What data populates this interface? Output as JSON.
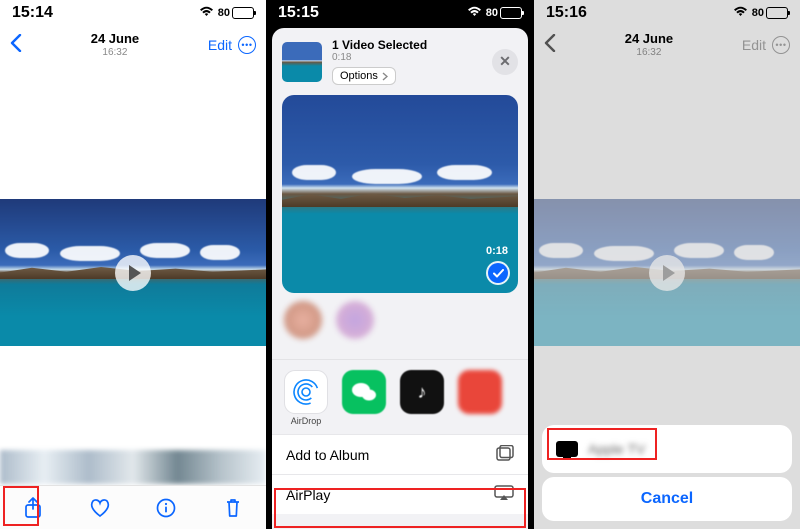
{
  "p1": {
    "time": "15:14",
    "battery": "80",
    "date": "24 June",
    "subtime": "16:32",
    "edit": "Edit",
    "tools": {
      "share": "Share",
      "like": "Like",
      "info": "Info",
      "delete": "Delete"
    }
  },
  "p2": {
    "time": "15:15",
    "battery": "80",
    "selected_title": "1 Video Selected",
    "selected_sub": "0:18",
    "options": "Options",
    "duration": "0:18",
    "apps": {
      "airdrop": "AirDrop",
      "wechat": "",
      "tiktok": "",
      "more": ""
    },
    "rows": {
      "add_to_album": "Add to Album",
      "airplay": "AirPlay"
    }
  },
  "p3": {
    "time": "15:16",
    "battery": "80",
    "date": "24 June",
    "subtime": "16:32",
    "edit": "Edit",
    "device": "Apple TV",
    "cancel": "Cancel"
  }
}
